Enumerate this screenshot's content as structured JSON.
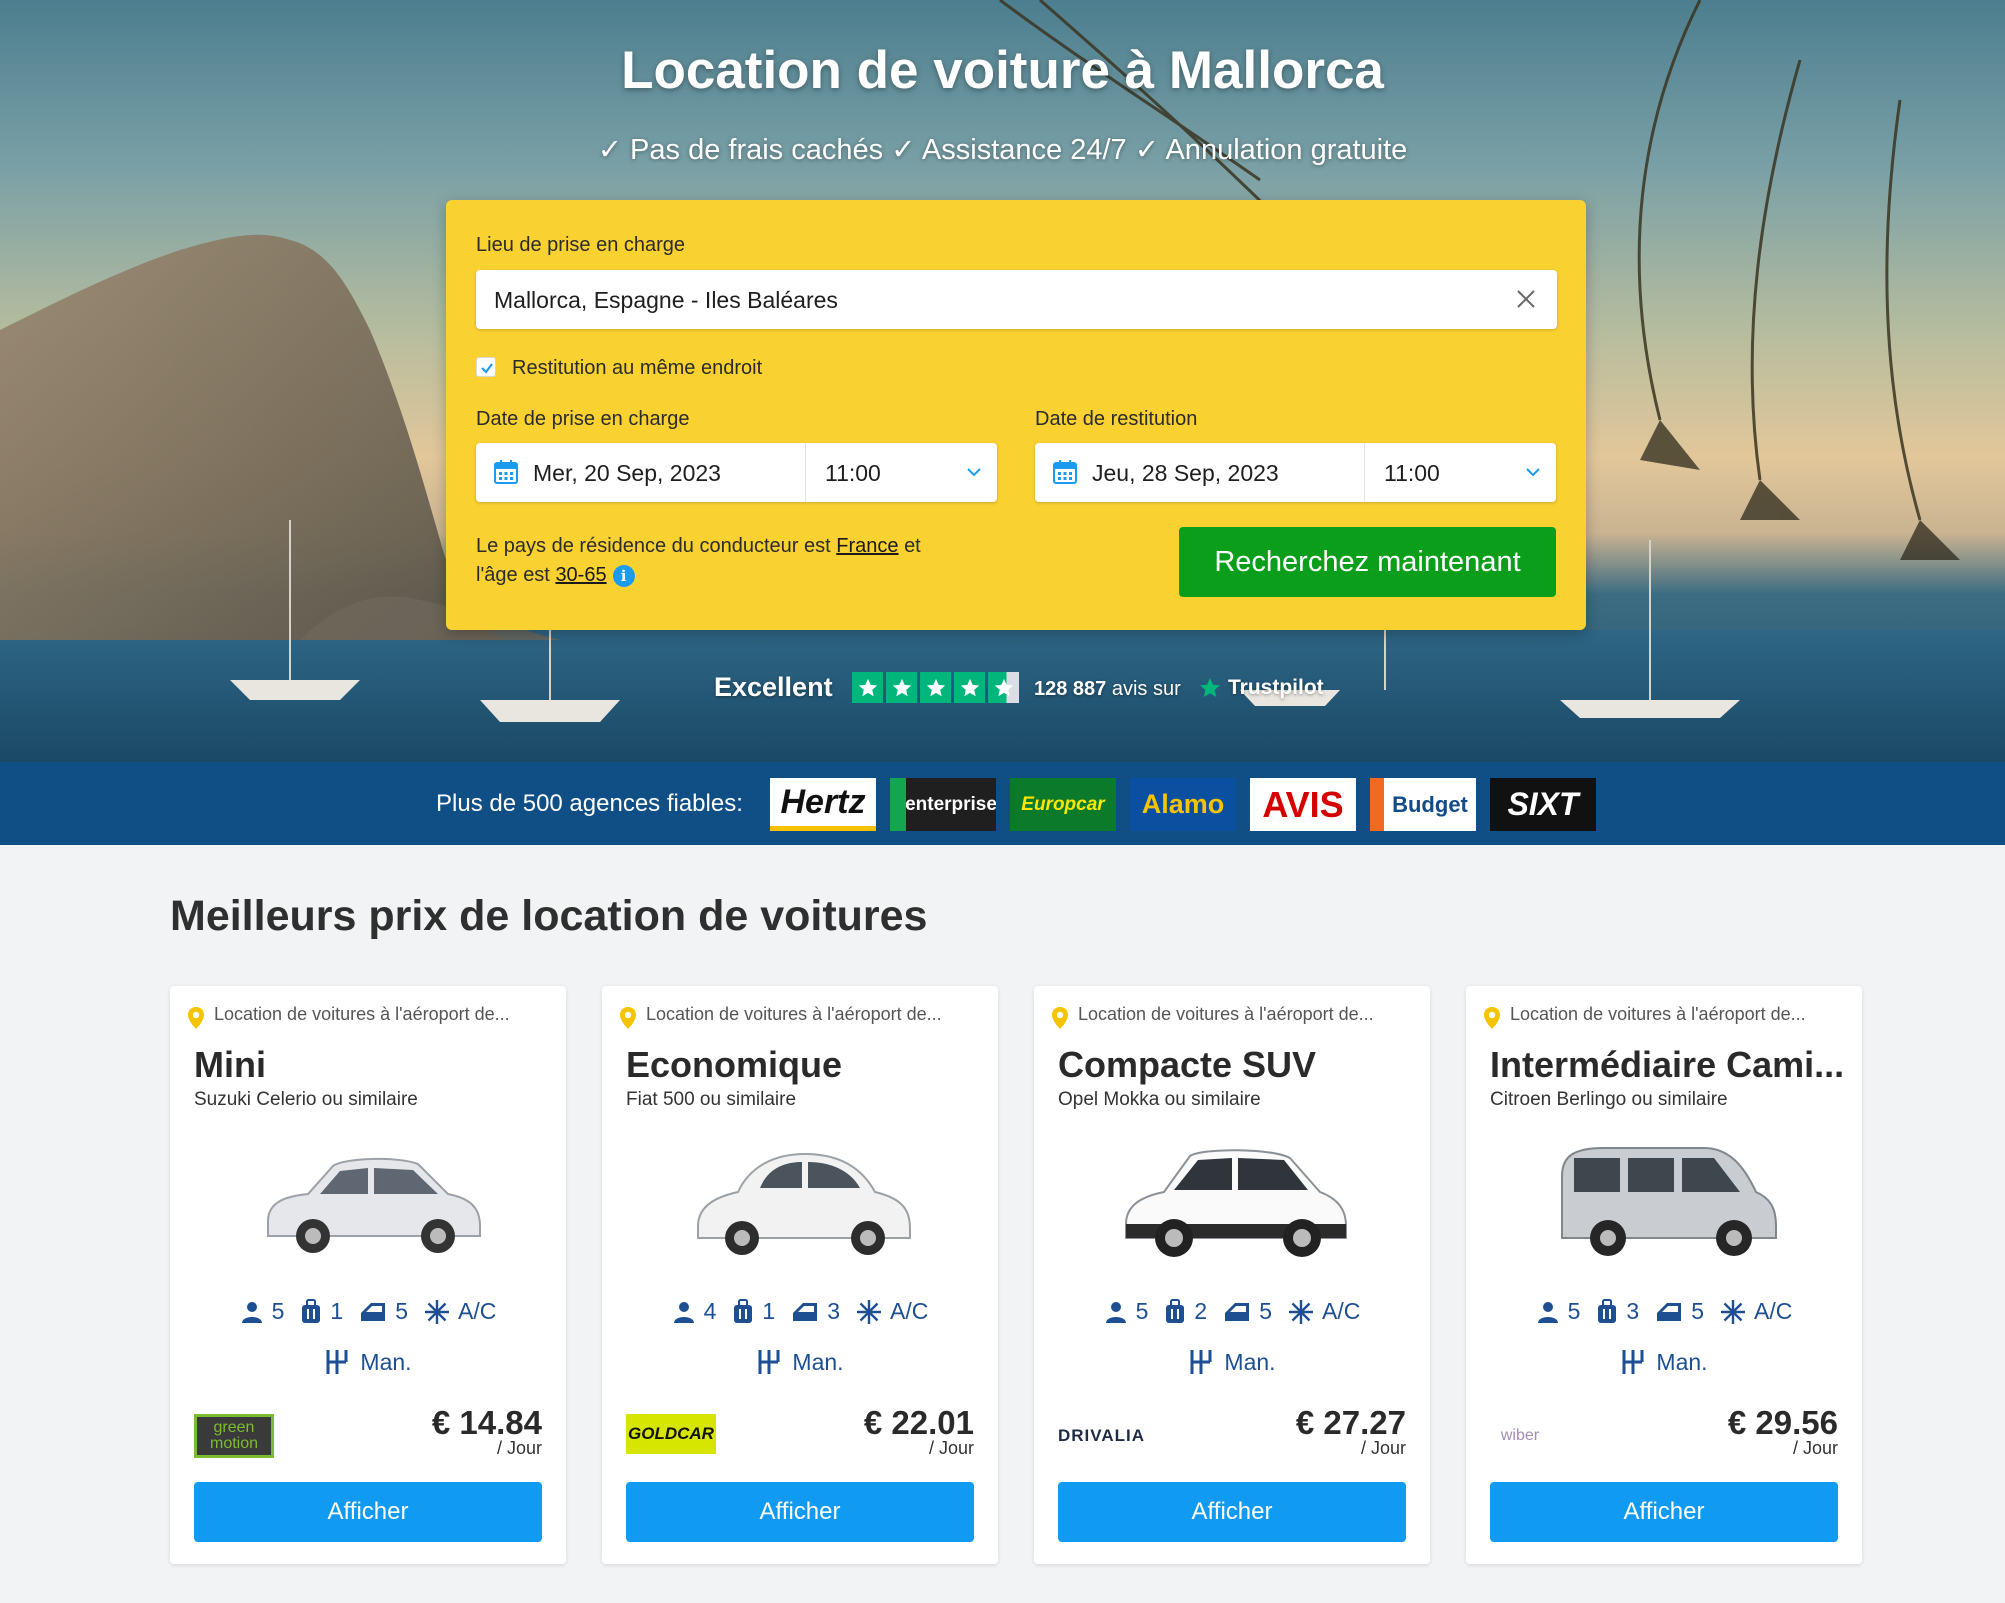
{
  "hero": {
    "title": "Location de voiture à Mallorca",
    "subtitle": "✓ Pas de frais cachés ✓ Assistance 24/7 ✓ Annulation gratuite"
  },
  "search": {
    "pickup_label": "Lieu de prise en charge",
    "pickup_value": "Mallorca, Espagne - Iles Baléares",
    "same_return_label": "Restitution au même endroit",
    "same_return_checked": true,
    "pickup_date_label": "Date de prise en charge",
    "pickup_date": "Mer, 20 Sep, 2023",
    "pickup_time": "11:00",
    "return_date_label": "Date de restitution",
    "return_date": "Jeu, 28 Sep, 2023",
    "return_time": "11:00",
    "residence_text_1": "Le pays de résidence du conducteur est",
    "residence_country": "France",
    "residence_text_2": "et",
    "residence_text_3": "l'âge est",
    "residence_age": "30-65",
    "search_button": "Recherchez maintenant"
  },
  "trustpilot": {
    "rating_word": "Excellent",
    "stars": 4.5,
    "count": "128 887",
    "reviews_on": "avis sur",
    "brand": "Trustpilot"
  },
  "agencies": {
    "lead": "Plus de 500 agences fiables:",
    "logos": [
      "Hertz",
      "enterprise",
      "Europcar",
      "Alamo",
      "AVIS",
      "Budget",
      "SIXT"
    ]
  },
  "section_title": "Meilleurs prix de location de voitures",
  "cards": [
    {
      "location": "Location de voitures à l'aéroport de...",
      "category": "Mini",
      "model": "Suzuki Celerio ou similaire",
      "seats": "5",
      "bags": "1",
      "doors": "5",
      "ac": "A/C",
      "transmission": "Man.",
      "supplier": "green motion",
      "price": "€ 14.84",
      "per": "/ Jour",
      "button": "Afficher"
    },
    {
      "location": "Location de voitures à l'aéroport de...",
      "category": "Economique",
      "model": "Fiat 500 ou similaire",
      "seats": "4",
      "bags": "1",
      "doors": "3",
      "ac": "A/C",
      "transmission": "Man.",
      "supplier": "GOLDCAR",
      "price": "€ 22.01",
      "per": "/ Jour",
      "button": "Afficher"
    },
    {
      "location": "Location de voitures à l'aéroport de...",
      "category": "Compacte SUV",
      "model": "Opel Mokka ou similaire",
      "seats": "5",
      "bags": "2",
      "doors": "5",
      "ac": "A/C",
      "transmission": "Man.",
      "supplier": "DRIVALIA",
      "price": "€ 27.27",
      "per": "/ Jour",
      "button": "Afficher"
    },
    {
      "location": "Location de voitures à l'aéroport de...",
      "category": "Intermédiaire Cami...",
      "model": "Citroen Berlingo ou similaire",
      "seats": "5",
      "bags": "3",
      "doors": "5",
      "ac": "A/C",
      "transmission": "Man.",
      "supplier": "wiber",
      "price": "€ 29.56",
      "per": "/ Jour",
      "button": "Afficher"
    }
  ]
}
